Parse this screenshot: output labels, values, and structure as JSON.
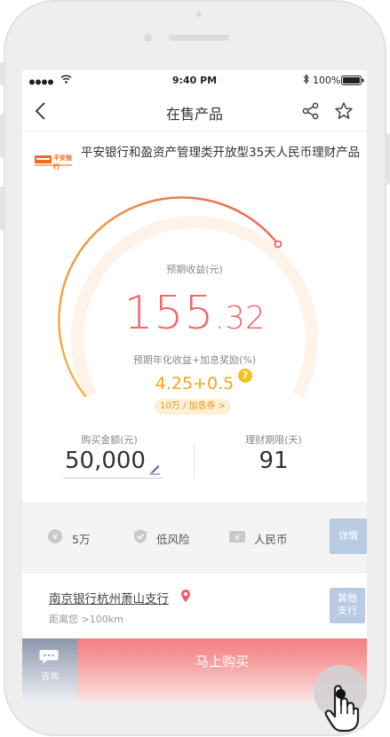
{
  "status_bar": {
    "time": "9:40 PM",
    "battery": "100%"
  },
  "nav": {
    "title": "在售产品"
  },
  "product": {
    "bank_logo_text": "平安银行",
    "name": "平安银行和盈资产管理类开放型35天人民币理财产品"
  },
  "gauge": {
    "expected_income_label": "预期收益(元)",
    "income_integer": "155",
    "income_decimal": ".32",
    "rate_label": "预期年化收益+加息奖励(%)",
    "rate_value": "4.25+0.5",
    "help_glyph": "?",
    "coupon_pill": "10万 / 加息券 >"
  },
  "inputs": {
    "amount_label": "购买金额(元)",
    "amount_value": "50,000",
    "term_label": "理财期限(天)",
    "term_value": "91"
  },
  "features": {
    "items": [
      {
        "label": "5万",
        "icon": "coin-icon"
      },
      {
        "label": "低风险",
        "icon": "shield-icon"
      },
      {
        "label": "人民币",
        "icon": "currency-icon"
      }
    ],
    "detail_button": "详情"
  },
  "branch": {
    "name": "南京银行杭州萧山支行",
    "distance": "距离您 >100km",
    "other_button_line1": "其他",
    "other_button_line2": "支行"
  },
  "bottom_bar": {
    "consult_label": "咨询",
    "buy_label": "马上购买"
  },
  "colors": {
    "accent_red": "#ef6a6b",
    "accent_orange": "#f2a51d",
    "button_blue": "#b9cbe3"
  }
}
